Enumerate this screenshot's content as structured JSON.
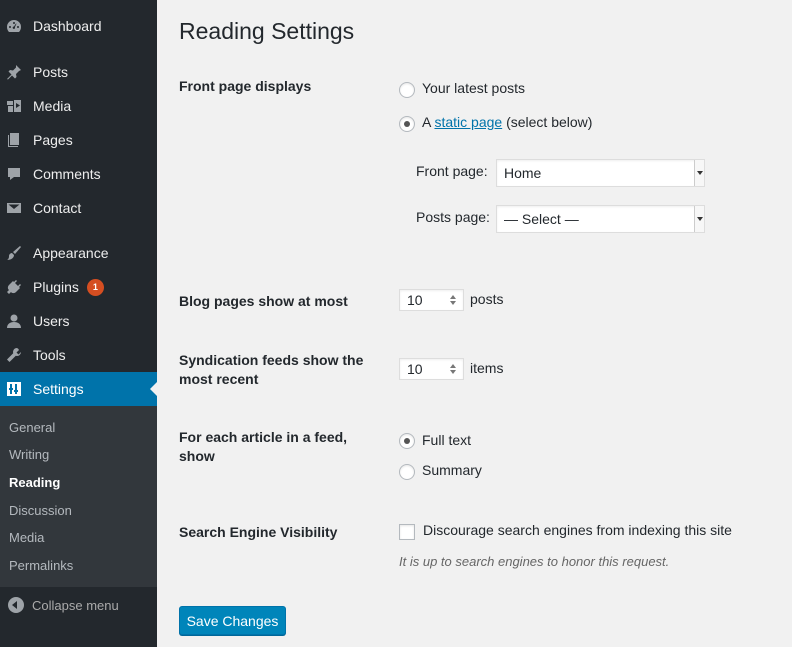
{
  "sidebar": {
    "items": [
      {
        "label": "Dashboard",
        "icon": "dashboard-icon"
      },
      {
        "label": "Posts",
        "icon": "pin-icon"
      },
      {
        "label": "Media",
        "icon": "media-icon"
      },
      {
        "label": "Pages",
        "icon": "pages-icon"
      },
      {
        "label": "Comments",
        "icon": "comment-icon"
      },
      {
        "label": "Contact",
        "icon": "envelope-icon"
      },
      {
        "label": "Appearance",
        "icon": "brush-icon"
      },
      {
        "label": "Plugins",
        "icon": "plug-icon",
        "badge": "1"
      },
      {
        "label": "Users",
        "icon": "user-icon"
      },
      {
        "label": "Tools",
        "icon": "wrench-icon"
      },
      {
        "label": "Settings",
        "icon": "settings-icon",
        "active": true
      }
    ],
    "submenu": [
      "General",
      "Writing",
      "Reading",
      "Discussion",
      "Media",
      "Permalinks"
    ],
    "submenu_current": "Reading",
    "collapse_label": "Collapse menu"
  },
  "main": {
    "title": "Reading Settings",
    "front_page_displays": {
      "label": "Front page displays",
      "option_latest": "Your latest posts",
      "option_static_prefix": "A",
      "option_static_link": "static page",
      "option_static_suffix": "(select below)",
      "selected": "static",
      "front_page_label": "Front page:",
      "front_page_value": "Home",
      "posts_page_label": "Posts page:",
      "posts_page_value": "— Select —"
    },
    "blog_pages": {
      "label": "Blog pages show at most",
      "value": "10",
      "unit": "posts"
    },
    "syndication": {
      "label_line1": "Syndication feeds show the",
      "label_line2": "most recent",
      "value": "10",
      "unit": "items"
    },
    "feed_article": {
      "label_line1": "For each article in a feed,",
      "label_line2": "show",
      "option_full": "Full text",
      "option_summary": "Summary",
      "selected": "full"
    },
    "search_visibility": {
      "label": "Search Engine Visibility",
      "checkbox_label": "Discourage search engines from indexing this site",
      "checked": false,
      "description": "It is up to search engines to honor this request."
    },
    "save_button": "Save Changes"
  },
  "colors": {
    "sidebar_bg": "#23282d",
    "submenu_bg": "#32373c",
    "active_bg": "#0073aa",
    "page_bg": "#f1f1f1",
    "button_bg": "#0085ba",
    "badge_bg": "#d54e21",
    "link": "#0073aa"
  }
}
